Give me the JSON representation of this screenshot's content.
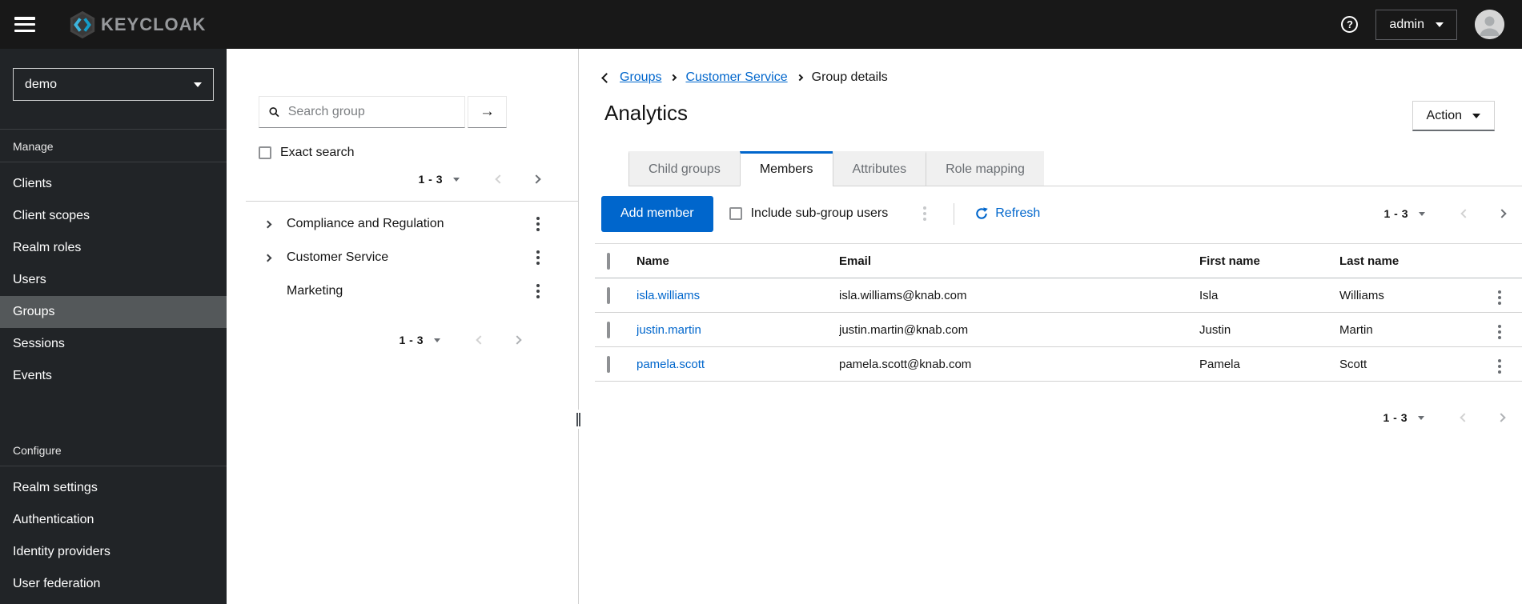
{
  "header": {
    "brand_text": "KEYCLOAK",
    "help_label": "?",
    "user": "admin"
  },
  "sidebar": {
    "realm": "demo",
    "manage_label": "Manage",
    "manage_items": [
      "Clients",
      "Client scopes",
      "Realm roles",
      "Users",
      "Groups",
      "Sessions",
      "Events"
    ],
    "active_item": "Groups",
    "configure_label": "Configure",
    "configure_items": [
      "Realm settings",
      "Authentication",
      "Identity providers",
      "User federation"
    ]
  },
  "groups_panel": {
    "search_placeholder": "Search group",
    "search_value": "",
    "exact_search_label": "Exact search",
    "pager_top": "1 - 3",
    "pager_bottom": "1 - 3",
    "tree": [
      {
        "label": "Compliance and Regulation",
        "expandable": true
      },
      {
        "label": "Customer Service",
        "expandable": true
      },
      {
        "label": "Marketing",
        "expandable": false
      }
    ]
  },
  "main": {
    "breadcrumb": [
      "Groups",
      "Customer Service",
      "Group details"
    ],
    "title": "Analytics",
    "action_button": "Action",
    "tabs": [
      {
        "label": "Child groups",
        "active": false
      },
      {
        "label": "Members",
        "active": true
      },
      {
        "label": "Attributes",
        "active": false
      },
      {
        "label": "Role mapping",
        "active": false
      }
    ],
    "toolbar": {
      "add_member": "Add member",
      "include_subgroups": "Include sub-group users",
      "refresh": "Refresh",
      "pager": "1 - 3"
    },
    "table": {
      "columns": [
        "Name",
        "Email",
        "First name",
        "Last name"
      ],
      "rows": [
        {
          "name": "isla.williams",
          "email": "isla.williams@knab.com",
          "first": "Isla",
          "last": "Williams"
        },
        {
          "name": "justin.martin",
          "email": "justin.martin@knab.com",
          "first": "Justin",
          "last": "Martin"
        },
        {
          "name": "pamela.scott",
          "email": "pamela.scott@knab.com",
          "first": "Pamela",
          "last": "Scott"
        }
      ],
      "pager": "1 - 3"
    }
  },
  "colors": {
    "accent_blue": "#0066cc",
    "masthead_bg": "#181818",
    "sidebar_bg": "#212427",
    "sidebar_active_bg": "#54585a",
    "border_gray": "#d2d2d2"
  }
}
